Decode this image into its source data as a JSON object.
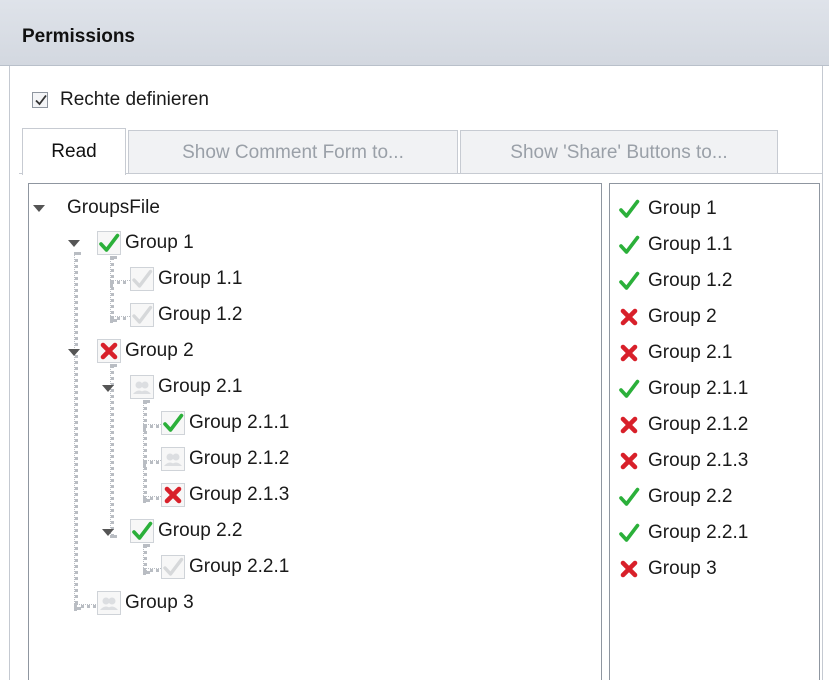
{
  "panel": {
    "title": "Permissions"
  },
  "define_rights": {
    "label": "Rechte definieren",
    "checked": true
  },
  "tabs": [
    {
      "label": "Read",
      "active": true
    },
    {
      "label": "Show Comment Form to...",
      "active": false
    },
    {
      "label": "Show 'Share' Buttons to...",
      "active": false
    }
  ],
  "tree": {
    "root": "GroupsFile",
    "nodes": [
      {
        "label": "Group 1",
        "state": "allow"
      },
      {
        "label": "Group 1.1",
        "state": "inherit-allow"
      },
      {
        "label": "Group 1.2",
        "state": "inherit-allow"
      },
      {
        "label": "Group 2",
        "state": "deny"
      },
      {
        "label": "Group 2.1",
        "state": "inherit"
      },
      {
        "label": "Group 2.1.1",
        "state": "allow"
      },
      {
        "label": "Group 2.1.2",
        "state": "inherit"
      },
      {
        "label": "Group 2.1.3",
        "state": "deny"
      },
      {
        "label": "Group 2.2",
        "state": "allow"
      },
      {
        "label": "Group 2.2.1",
        "state": "inherit-allow"
      },
      {
        "label": "Group 3",
        "state": "inherit"
      }
    ]
  },
  "effective": [
    {
      "label": "Group 1",
      "state": "allow"
    },
    {
      "label": "Group 1.1",
      "state": "allow"
    },
    {
      "label": "Group 1.2",
      "state": "allow"
    },
    {
      "label": "Group 2",
      "state": "deny"
    },
    {
      "label": "Group 2.1",
      "state": "deny"
    },
    {
      "label": "Group 2.1.1",
      "state": "allow"
    },
    {
      "label": "Group 2.1.2",
      "state": "deny"
    },
    {
      "label": "Group 2.1.3",
      "state": "deny"
    },
    {
      "label": "Group 2.2",
      "state": "allow"
    },
    {
      "label": "Group 2.2.1",
      "state": "allow"
    },
    {
      "label": "Group 3",
      "state": "deny"
    }
  ],
  "colors": {
    "allow": "#2bb03a",
    "deny": "#d8202a",
    "header_bg": "#d9dde4"
  },
  "icons": {
    "allow": "check-icon",
    "deny": "cross-icon",
    "inherit-allow": "faded-check-icon",
    "inherit": "group-icon"
  }
}
